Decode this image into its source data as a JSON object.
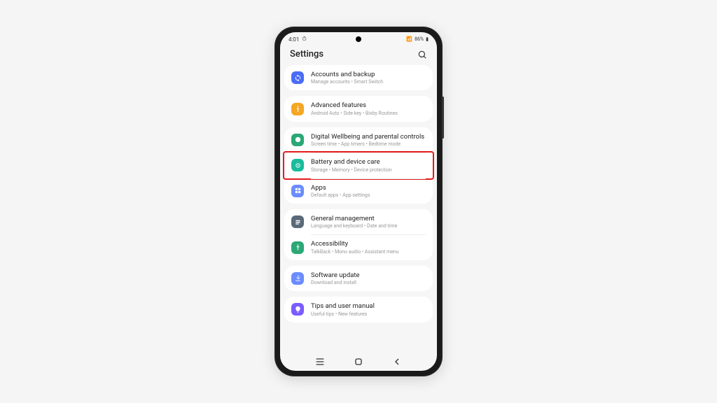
{
  "status": {
    "time": "4:01",
    "battery": "86%"
  },
  "header": {
    "title": "Settings"
  },
  "groups": [
    {
      "items": [
        {
          "title": "Accounts and backup",
          "sub": "Manage accounts • Smart Switch",
          "color": "#4a6cf7",
          "icon": "sync"
        }
      ]
    },
    {
      "items": [
        {
          "title": "Advanced features",
          "sub": "Android Auto • Side key • Bixby Routines",
          "color": "#f5a623",
          "icon": "advanced"
        }
      ]
    },
    {
      "items": [
        {
          "title": "Digital Wellbeing and parental controls",
          "sub": "Screen time • App timers • Bedtime mode",
          "color": "#2aa876",
          "icon": "wellbeing"
        },
        {
          "title": "Battery and device care",
          "sub": "Storage • Memory • Device protection",
          "color": "#1abc9c",
          "icon": "care",
          "highlighted": true
        },
        {
          "title": "Apps",
          "sub": "Default apps • App settings",
          "color": "#6b8cff",
          "icon": "apps"
        }
      ]
    },
    {
      "items": [
        {
          "title": "General management",
          "sub": "Language and keyboard • Date and time",
          "color": "#5a6978",
          "icon": "general"
        },
        {
          "title": "Accessibility",
          "sub": "TalkBack • Mono audio • Assistant menu",
          "color": "#2aa876",
          "icon": "accessibility"
        }
      ]
    },
    {
      "items": [
        {
          "title": "Software update",
          "sub": "Download and install",
          "color": "#6b8cff",
          "icon": "update"
        }
      ]
    },
    {
      "items": [
        {
          "title": "Tips and user manual",
          "sub": "Useful tips • New features",
          "color": "#7b5cff",
          "icon": "tips"
        }
      ]
    }
  ]
}
